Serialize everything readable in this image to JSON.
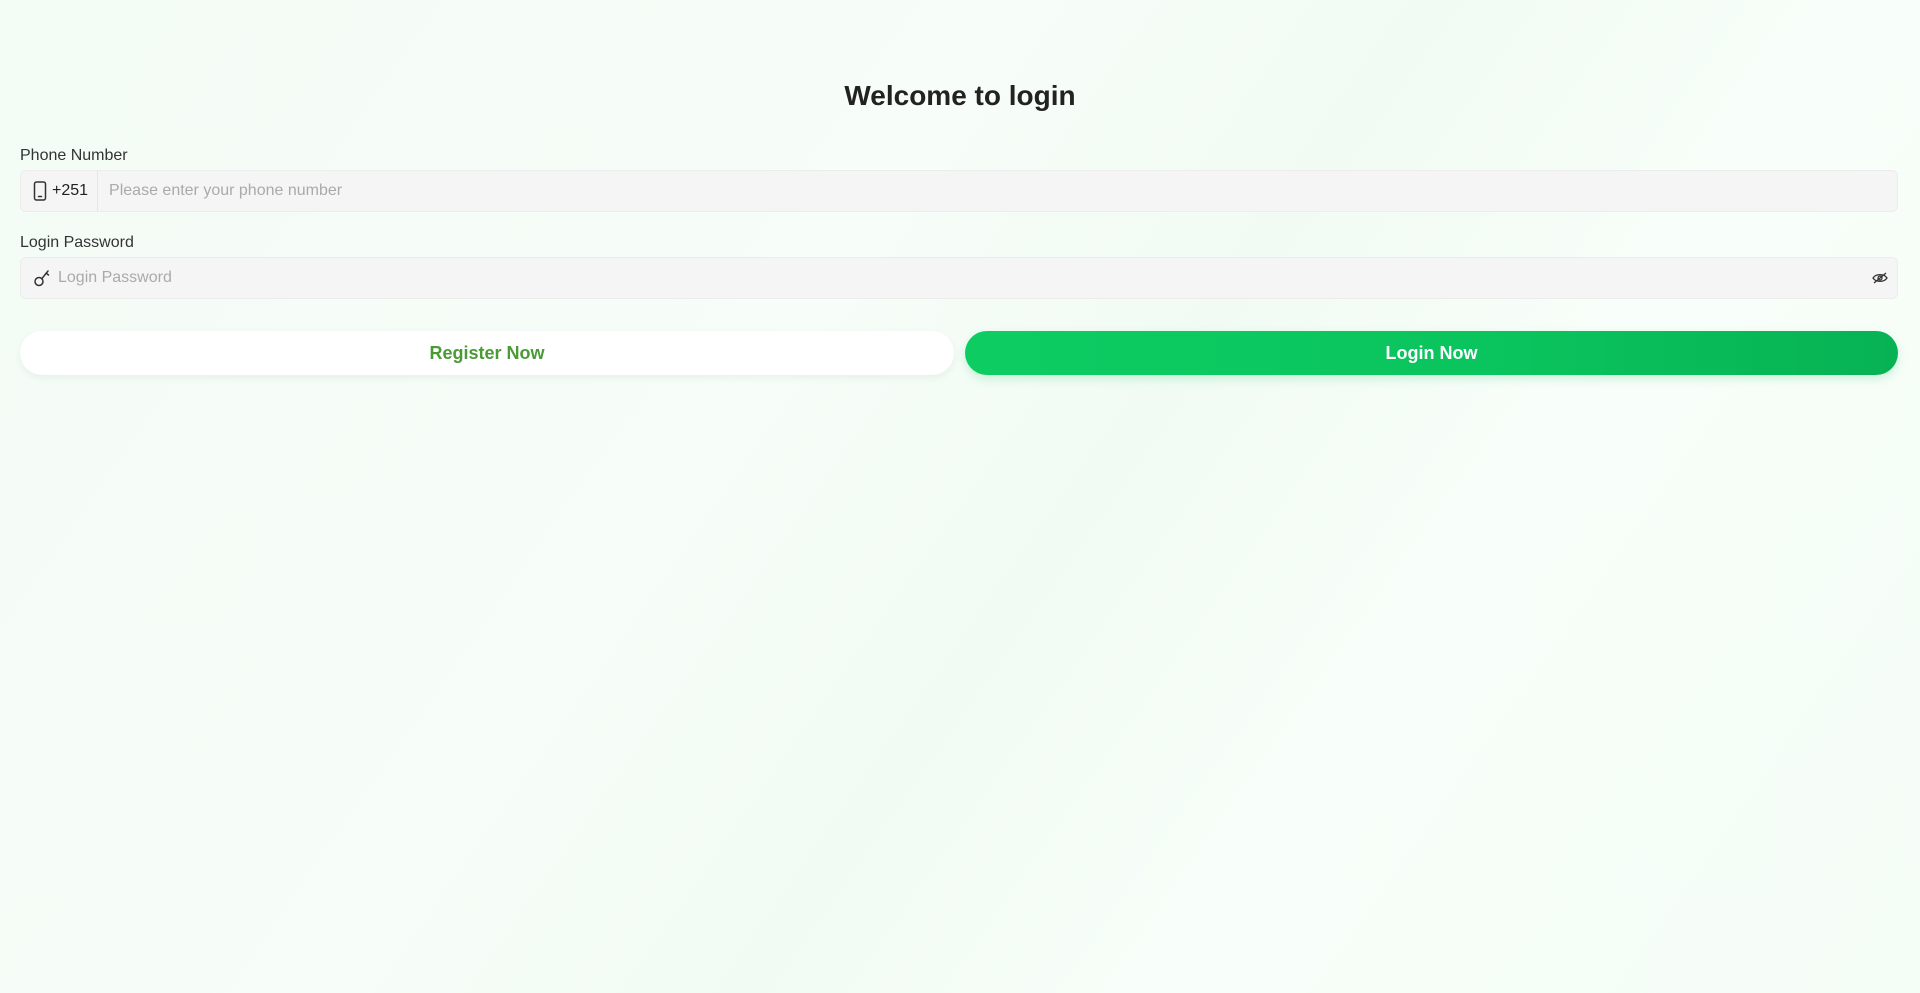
{
  "page": {
    "title": "Welcome to login"
  },
  "phone": {
    "label": "Phone Number",
    "icon": "phone-icon",
    "country_code": "+251",
    "placeholder": "Please enter your phone number",
    "value": ""
  },
  "password": {
    "label": "Login Password",
    "icon": "key-icon",
    "placeholder": "Login Password",
    "value": "",
    "toggle_icon": "eye-icon"
  },
  "actions": {
    "register_label": "Register Now",
    "login_label": "Login Now"
  },
  "colors": {
    "accent": "#0ac35d",
    "register_text": "#4a9a35"
  }
}
